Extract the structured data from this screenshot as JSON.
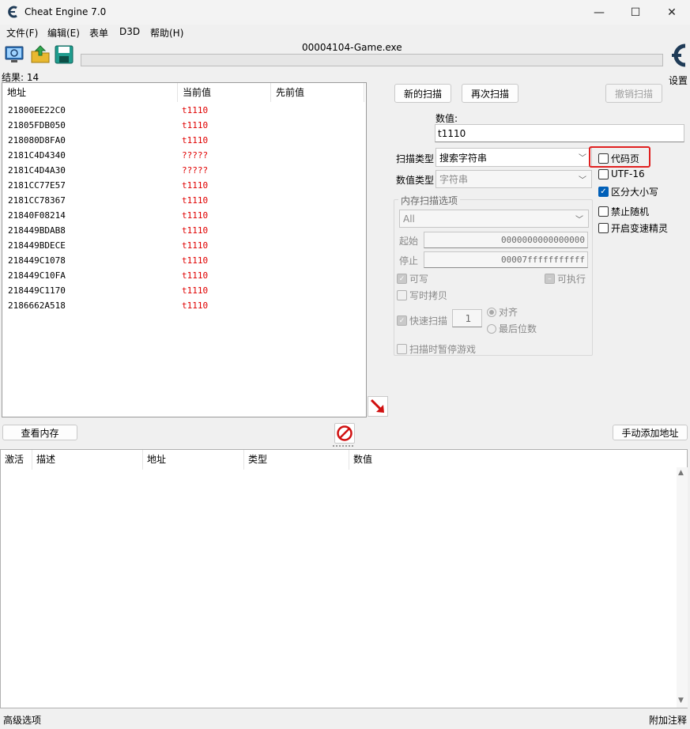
{
  "window": {
    "title": "Cheat Engine 7.0",
    "minimize_glyph": "—",
    "maximize_glyph": "☐",
    "close_glyph": "✕"
  },
  "menu": [
    "文件(F)",
    "编辑(E)",
    "表单",
    "D3D",
    "帮助(H)"
  ],
  "toolbar": {
    "process_name": "00004104-Game.exe",
    "settings_label": "设置",
    "icons": [
      "open-process-icon",
      "load-table-icon",
      "save-table-icon"
    ]
  },
  "results": {
    "count_label": "结果: 14",
    "columns": [
      "地址",
      "当前值",
      "先前值"
    ],
    "rows": [
      {
        "address": "21800EE22C0",
        "current": "t1110",
        "previous": ""
      },
      {
        "address": "21805FDB050",
        "current": "t1110",
        "previous": ""
      },
      {
        "address": "218080D8FA0",
        "current": "t1110",
        "previous": ""
      },
      {
        "address": "2181C4D4340",
        "current": "?????",
        "previous": ""
      },
      {
        "address": "2181C4D4A30",
        "current": "?????",
        "previous": ""
      },
      {
        "address": "2181CC77E57",
        "current": "t1110",
        "previous": ""
      },
      {
        "address": "2181CC78367",
        "current": "t1110",
        "previous": ""
      },
      {
        "address": "21840F08214",
        "current": "t1110",
        "previous": ""
      },
      {
        "address": "218449BDAB8",
        "current": "t1110",
        "previous": ""
      },
      {
        "address": "218449BDECE",
        "current": "t1110",
        "previous": ""
      },
      {
        "address": "218449C1078",
        "current": "t1110",
        "previous": ""
      },
      {
        "address": "218449C10FA",
        "current": "t1110",
        "previous": ""
      },
      {
        "address": "218449C1170",
        "current": "t1110",
        "previous": ""
      },
      {
        "address": "2186662A518",
        "current": "t1110",
        "previous": ""
      }
    ]
  },
  "scan": {
    "new_scan": "新的扫描",
    "next_scan": "再次扫描",
    "undo_scan": "撤销扫描",
    "value_label": "数值:",
    "value": "t1110",
    "scan_type_label": "扫描类型",
    "scan_type_value": "搜索字符串",
    "value_type_label": "数值类型",
    "value_type_value": "字符串",
    "options": {
      "codepage": "代码页",
      "utf16": "UTF-16",
      "case_sensitive": "区分大小写",
      "no_random": "禁止随机",
      "speedhack": "开启变速精灵"
    },
    "memory": {
      "title": "内存扫描选项",
      "region": "All",
      "start_label": "起始",
      "start_value": "0000000000000000",
      "stop_label": "停止",
      "stop_value": "00007fffffffffff",
      "writable": "可写",
      "executable": "可执行",
      "copy_on_write": "写时拷贝",
      "fast_scan": "快速扫描",
      "fast_scan_value": "1",
      "align": "对齐",
      "last_digits": "最后位数",
      "pause_game": "扫描时暂停游戏"
    }
  },
  "actions": {
    "view_memory": "查看内存",
    "add_address": "手动添加地址"
  },
  "address_table": {
    "columns": [
      "激活",
      "描述",
      "地址",
      "类型",
      "数值"
    ]
  },
  "footer": {
    "advanced": "高级选项",
    "comments": "附加注释"
  }
}
